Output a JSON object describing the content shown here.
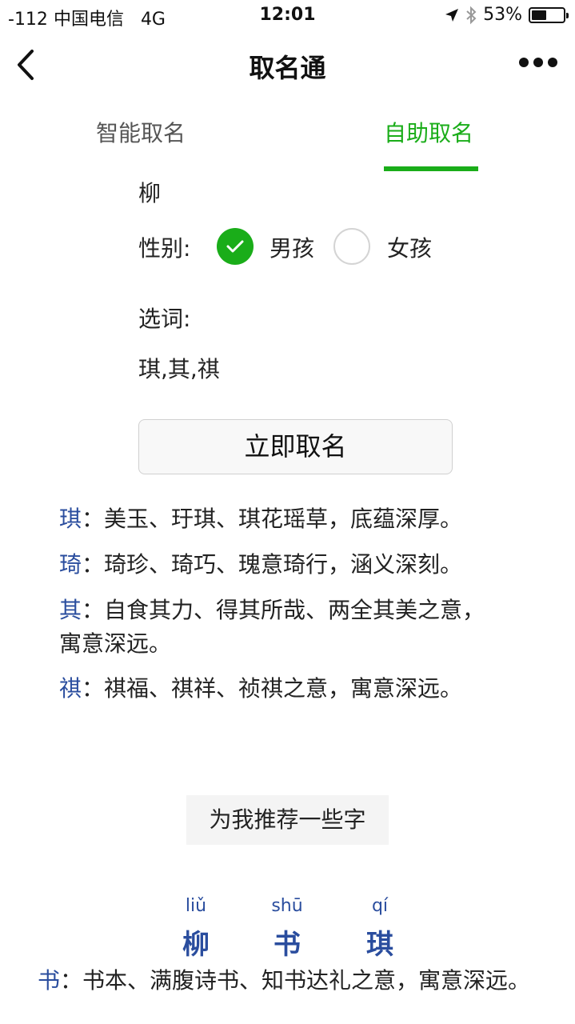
{
  "status_bar": {
    "signal": "-112",
    "carrier": "中国电信",
    "network": "4G",
    "time": "12:01",
    "battery": "53%",
    "battery_level": 0.53
  },
  "nav": {
    "title": "取名通"
  },
  "tabs": [
    {
      "label": "智能取名",
      "active": false
    },
    {
      "label": "自助取名",
      "active": true
    }
  ],
  "form": {
    "surname": "柳",
    "gender_label": "性别:",
    "gender_options": [
      {
        "label": "男孩",
        "selected": true
      },
      {
        "label": "女孩",
        "selected": false
      }
    ],
    "words_label": "选词:",
    "words_value": "琪,其,祺",
    "submit_label": "立即取名"
  },
  "meanings": [
    {
      "char": "琪",
      "sep": "：",
      "text": "美玉、玗琪、琪花瑶草，底蕴深厚。"
    },
    {
      "char": "琦",
      "sep": "：",
      "text": "琦珍、琦巧、瑰意琦行，涵义深刻。"
    },
    {
      "char": "其",
      "sep": "：",
      "text": "自食其力、得其所哉、两全其美之意，寓意深远。"
    },
    {
      "char": "祺",
      "sep": "：",
      "text": "祺福、祺祥、祯祺之意，寓意深远。"
    }
  ],
  "recommend_label": "为我推荐一些字",
  "result_name": [
    {
      "pinyin": "liǔ",
      "char": "柳"
    },
    {
      "pinyin": "shū",
      "char": "书"
    },
    {
      "pinyin": "qí",
      "char": "琪"
    }
  ],
  "result_meaning": {
    "char": "书",
    "sep": "：",
    "text": "书本、满腹诗书、知书达礼之意，寓意深远。"
  },
  "colors": {
    "accent_green": "#1aad19",
    "char_blue": "#2a4d9e"
  }
}
